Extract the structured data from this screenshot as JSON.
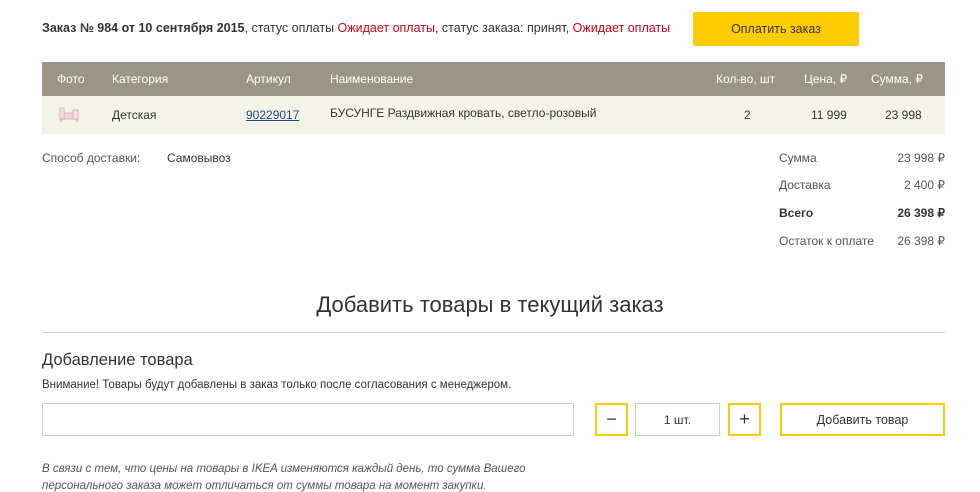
{
  "order_header": {
    "prefix": "Заказ № 984 от 10 сентября 2015",
    "payment_status_label": ", статус оплаты ",
    "payment_status": "Ожидает оплаты",
    "order_status_label": ", статус заказа: принят, ",
    "order_status": "Ожидает оплаты",
    "pay_button": "Оплатить заказ"
  },
  "colors": {
    "accent": "#ffcc00",
    "status_red": "#d0021b",
    "table_header": "#9a9585",
    "row_bg": "#f5f3e7"
  },
  "table": {
    "headers": {
      "photo": "Фото",
      "category": "Категория",
      "sku": "Артикул",
      "name": "Наименование",
      "qty": "Кол-во, шт",
      "price": "Цена, ₽",
      "total": "Сумма, ₽"
    },
    "rows": [
      {
        "category": "Детская",
        "sku": "90229017",
        "name": "БУСУНГЕ Раздвижная кровать, светло-розовый",
        "qty": "2",
        "price": "11 999",
        "total": "23 998",
        "photo_icon": "bed-thumbnail"
      }
    ]
  },
  "delivery": {
    "label": "Способ доставки:",
    "value": "Самовывоз"
  },
  "summary": {
    "sum_label": "Сумма",
    "sum_value": "23 998 ₽",
    "delivery_label": "Доставка",
    "delivery_value": "2 400 ₽",
    "total_label": "Всего",
    "total_value": "26 398 ₽",
    "remaining_label": "Остаток к оплате",
    "remaining_value": "26 398 ₽"
  },
  "add_section": {
    "title": "Добавить товары в текущий заказ",
    "subtitle": "Добавление товара",
    "note": "Внимание! Товары будут добавлены в заказ только после согласования с менеджером.",
    "input_value": "",
    "minus": "−",
    "qty": "1 шт.",
    "plus": "+",
    "add_button": "Добавить товар",
    "disclaimer_line1": "В связи с тем, что цены на товары в IKEA изменяются каждый день, то сумма Вашего",
    "disclaimer_line2": "персонального заказа может отличаться от суммы товара на момент закупки."
  }
}
